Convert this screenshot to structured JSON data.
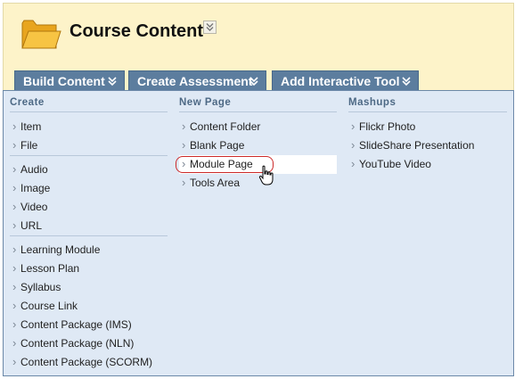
{
  "header": {
    "title": "Course Content",
    "folder_icon": "folder-icon",
    "background": "#fdf3c9"
  },
  "tabs": [
    {
      "label": "Build Content",
      "icon": "chevron-down-icon"
    },
    {
      "label": "Create Assessment",
      "icon": "chevron-down-icon"
    },
    {
      "label": "Add Interactive Tool",
      "icon": "chevron-down-icon"
    }
  ],
  "menu": {
    "create": {
      "header": "Create",
      "group1": [
        "Item",
        "File"
      ],
      "group2": [
        "Audio",
        "Image",
        "Video",
        "URL"
      ],
      "group3": [
        "Learning Module",
        "Lesson Plan",
        "Syllabus",
        "Course Link",
        "Content Package (IMS)",
        "Content Package (NLN)",
        "Content Package (SCORM)"
      ]
    },
    "new_page": {
      "header": "New Page",
      "items": [
        "Content Folder",
        "Blank Page",
        "Module Page",
        "Tools Area"
      ],
      "highlighted": "Module Page"
    },
    "mashups": {
      "header": "Mashups",
      "items": [
        "Flickr Photo",
        "SlideShare Presentation",
        "YouTube Video"
      ]
    }
  },
  "colors": {
    "tab_bg": "#5c7d9e",
    "menu_bg": "#dfe9f5",
    "highlight_ring": "#cc2a2a"
  }
}
